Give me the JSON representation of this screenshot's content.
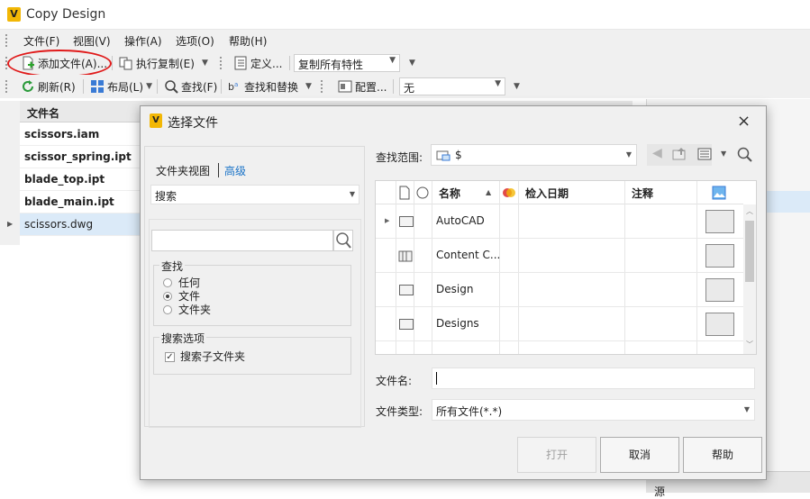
{
  "app": {
    "title": "Copy Design",
    "icon_letter": "V"
  },
  "menu": [
    "文件(F)",
    "视图(V)",
    "操作(A)",
    "选项(O)",
    "帮助(H)"
  ],
  "toolbar1": {
    "add_file": "添加文件(A)...",
    "execute_copy": "执行复制(E)",
    "define": "定义...",
    "copy_props_value": "复制所有特性"
  },
  "toolbar2": {
    "refresh": "刷新(R)",
    "layout": "布局(L)",
    "find": "查找(F)",
    "find_replace": "查找和替换",
    "config": "配置...",
    "config_value": "无"
  },
  "grid": {
    "header": "文件名",
    "rows": [
      "scissors.iam",
      "scissor_spring.ipt",
      "blade_top.ipt",
      "blade_main.ipt",
      "scissors.dwg"
    ],
    "selected_row": 4
  },
  "right_panel": {
    "source_label": "源"
  },
  "dialog": {
    "title": "选择文件",
    "icon_letter": "V",
    "close": "×",
    "left": {
      "view_label": "文件夹视图",
      "advanced_link": "高级",
      "search_type": "搜索",
      "search_placeholder": "",
      "find_group": "查找",
      "find_options": [
        "任何",
        "文件",
        "文件夹"
      ],
      "find_selected": 1,
      "search_options_group": "搜索选项",
      "search_subfolders": "搜索子文件夹",
      "search_subfolders_checked": true
    },
    "look_in_label": "查找范围:",
    "look_in_value": "$",
    "columns": {
      "name": "名称",
      "checkin_date": "检入日期",
      "comment": "注释"
    },
    "files": [
      {
        "name": "AutoCAD",
        "kind": "folder",
        "expandable": true
      },
      {
        "name": "Content C...",
        "kind": "content-center",
        "expandable": false
      },
      {
        "name": "Design",
        "kind": "folder",
        "expandable": false
      },
      {
        "name": "Designs",
        "kind": "folder",
        "expandable": false
      }
    ],
    "filename_label": "文件名:",
    "filename_value": "",
    "filetype_label": "文件类型:",
    "filetype_value": "所有文件(*.*)",
    "buttons": {
      "open": "打开",
      "cancel": "取消",
      "help": "帮助"
    }
  },
  "colors": {
    "accent_link": "#1a73c7",
    "highlight_ring": "#e01a1a",
    "app_icon": "#f2b705",
    "selection": "#dbeaf8"
  }
}
